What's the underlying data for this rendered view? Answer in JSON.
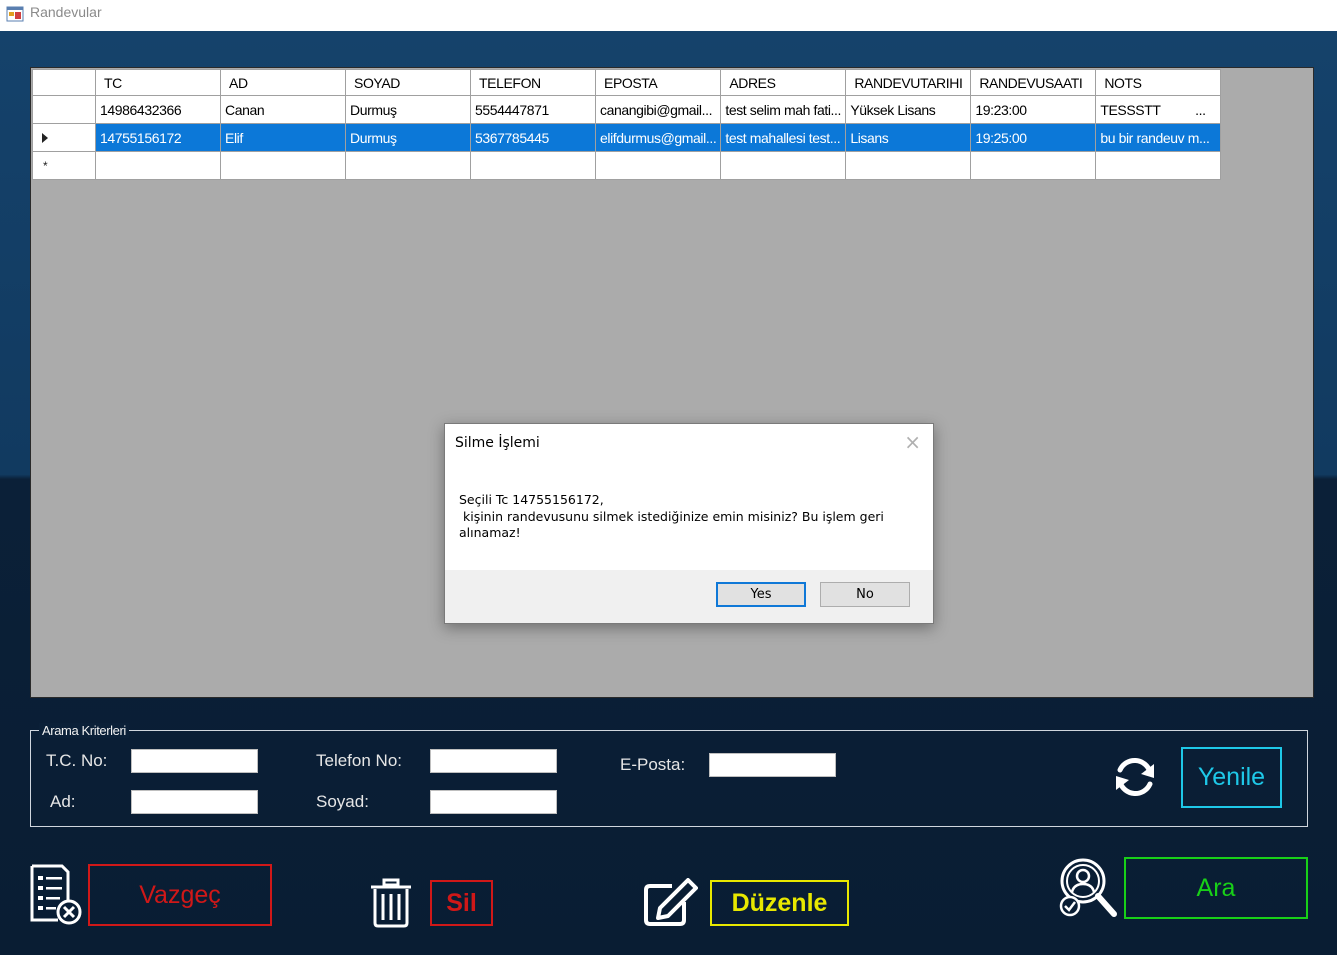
{
  "window": {
    "title": "Randevular",
    "icon": "windows-form-icon"
  },
  "grid": {
    "columns": [
      "TC",
      "AD",
      "SOYAD",
      "TELEFON",
      "EPOSTA",
      "ADRES",
      "RANDEVUTARIHI",
      "RANDEVUSAATI",
      "NOTS"
    ],
    "rows": [
      {
        "TC": "14986432366",
        "AD": "Canan",
        "SOYAD": "Durmuş",
        "TELEFON": "5554447871",
        "EPOSTA": "canangibi@gmail...",
        "ADRES": "test selim mah fati...",
        "RANDEVUTARIHI": "Yüksek Lisans",
        "RANDEVUSAATI": "19:23:00",
        "NOTS": "TESSSTT          ...",
        "selected": false
      },
      {
        "TC": "14755156172",
        "AD": "Elif",
        "SOYAD": "Durmuş",
        "TELEFON": "5367785445",
        "EPOSTA": "elifdurmus@gmail...",
        "ADRES": "test mahallesi test...",
        "RANDEVUTARIHI": "Lisans",
        "RANDEVUSAATI": "19:25:00",
        "NOTS": "bu bir randeuv m...",
        "selected": true
      }
    ],
    "new_row_marker": "*"
  },
  "dialog": {
    "title": "Silme İşlemi",
    "message": "Seçili Tc 14755156172,\n kişinin randevusunu silmek istediğinize emin misiniz? Bu işlem geri alınamaz!",
    "yes_label": "Yes",
    "no_label": "No"
  },
  "criteria": {
    "legend": "Arama Kriterleri",
    "tc_label": "T.C. No:",
    "ad_label": "Ad:",
    "telefon_label": "Telefon No:",
    "soyad_label": "Soyad:",
    "eposta_label": "E-Posta:",
    "tc_value": "",
    "ad_value": "",
    "telefon_value": "",
    "soyad_value": "",
    "eposta_value": ""
  },
  "buttons": {
    "yenile": "Yenile",
    "vazgec": "Vazgeç",
    "sil": "Sil",
    "duzenle": "Düzenle",
    "ara": "Ara"
  },
  "colors": {
    "selection": "#0c78d8",
    "cancel_red": "#d01818",
    "edit_yellow": "#e8e800",
    "search_green": "#18d018",
    "refresh_cyan": "#1ec8e8"
  }
}
